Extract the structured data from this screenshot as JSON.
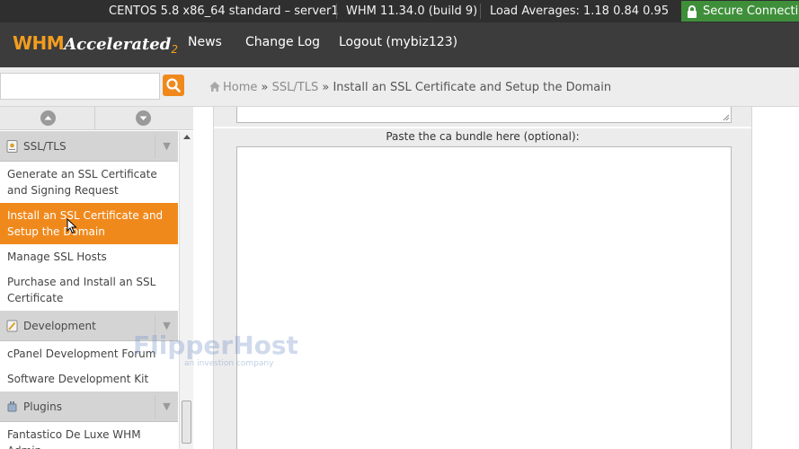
{
  "statusbar": {
    "server": "CENTOS 5.8 x86_64 standard – server1",
    "version": "WHM 11.34.0 (build 9)",
    "load": "Load Averages: 1.18 0.84 0.95",
    "secure": "Secure Connection"
  },
  "header": {
    "logo_main": "WHM",
    "logo_accent": "Accelerated",
    "logo_version": "2",
    "nav": [
      "News",
      "Change Log",
      "Logout (mybiz123)"
    ]
  },
  "search": {
    "value": "",
    "placeholder": ""
  },
  "breadcrumb": {
    "home": "Home",
    "sep": "»",
    "section": "SSL/TLS",
    "current": "Install an SSL Certificate and Setup the Domain"
  },
  "sidebar": {
    "sections": [
      {
        "title": "SSL/TLS",
        "items": [
          "Generate an SSL Certificate and Signing Request",
          "Install an SSL Certificate and Setup the Domain",
          "Manage SSL Hosts",
          "Purchase and Install an SSL Certificate"
        ]
      },
      {
        "title": "Development",
        "items": [
          "cPanel Development Forum",
          "Software Development Kit"
        ]
      },
      {
        "title": "Plugins",
        "items": [
          "Fantastico De Luxe WHM Admin"
        ]
      }
    ],
    "active_item": "Install an SSL Certificate and Setup the Domain"
  },
  "main": {
    "ca_bundle_label": "Paste the ca bundle here (optional):",
    "ca_bundle_value": ""
  },
  "watermark": {
    "brand": "FlipperHost",
    "tagline": "an investion company"
  },
  "colors": {
    "accent_orange": "#f0891c",
    "header_bg": "#3c3c3c",
    "statusbar_bg": "#2f2f2f",
    "secure_green": "#3f8f3a"
  }
}
